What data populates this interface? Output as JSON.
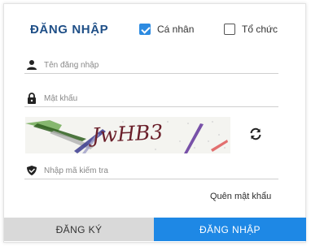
{
  "form": {
    "title": "ĐĂNG NHẬP",
    "options": {
      "personal": {
        "label": "Cá nhân",
        "checked": true
      },
      "organization": {
        "label": "Tổ chức",
        "checked": false
      }
    },
    "username": {
      "placeholder": "Tên đăng nhập",
      "icon": "user-icon"
    },
    "password": {
      "placeholder": "Mật khẩu",
      "icon": "lock-icon"
    },
    "captcha": {
      "text": "JwHB3",
      "refresh_icon": "refresh-icon"
    },
    "captcha_input": {
      "placeholder": "Nhập mã kiểm tra",
      "icon": "shield-icon"
    },
    "forgot_password": "Quên mật khẩu"
  },
  "buttons": {
    "register": "ĐĂNG KÝ",
    "login": "ĐĂNG NHẬP"
  },
  "colors": {
    "accent": "#1e88e5",
    "title": "#1f4f87",
    "register_bg": "#d9d9d9"
  }
}
